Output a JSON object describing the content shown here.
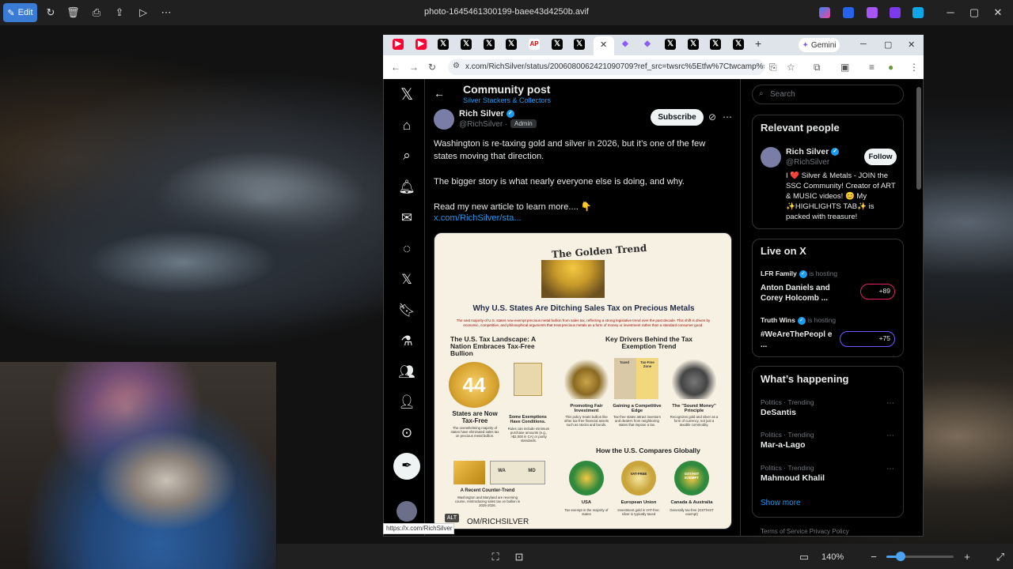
{
  "viewer": {
    "edit_label": "Edit",
    "title": "photo-1645461300199-baee43d4250b.avif",
    "zoom": "140%"
  },
  "browser": {
    "tab_labels": [
      "AP"
    ],
    "gemini_label": "Gemini",
    "address": "x.com/RichSilver/status/2006080062421090709?ref_src=twsrc%5Etfw%7Ctwcamp%5Etwe...",
    "status_url": "https://x.com/RichSilver"
  },
  "post": {
    "page_title": "Community post",
    "community": "Silver Stackers & Collectors",
    "author_name": "Rich Silver",
    "author_handle": "@RichSilver ·",
    "admin_badge": "Admin",
    "subscribe_label": "Subscribe",
    "para1": "Washington is re-taxing gold and silver in 2026, but it’s one of the few states moving that direction.",
    "para2": "The bigger story is what nearly everyone else is doing, and why.",
    "para3": "Read my new article to learn more.... 👇",
    "link": "x.com/RichSilver/sta...",
    "alt_badge": "ALT",
    "image_footer": "OM/RICHSILVER"
  },
  "infographic": {
    "trend_title": "The Golden Trend",
    "headline": "Why U.S. States Are Ditching Sales Tax on Precious Metals",
    "subline": "The vast majority of U.S. states now exempt precious metal bullion from sales tax, reflecting a strong legislative trend over the past decade. This shift is driven by economic, competitive, and philosophical arguments that treat precious metals as a form of money or investment rather than a standard consumer good.",
    "landscape_title": "The U.S. Tax Landscape: A Nation Embraces Tax-Free Bullion",
    "badge_number": "44",
    "states_now": "States are Now Tax-Free",
    "states_now_desc": "The overwhelming majority of states have eliminated sales tax on precious metal bullion.",
    "exemptions": "Some Exemptions Have Conditions.",
    "exemptions_desc": "Rules can include minimum purchase amounts (e.g., >$2,000 in CA) or purity standards.",
    "drivers_title": "Key Drivers Behind the Tax Exemption Trend",
    "drivers": [
      {
        "title": "Promoting Fair Investment",
        "desc": "This policy treats bullion like other tax-free financial assets such as stocks and bonds."
      },
      {
        "title": "Gaining a Competitive Edge",
        "desc": "Tax-free states attract investors and dealers from neighboring states that impose a tax."
      },
      {
        "title": "The \"Sound Money\" Principle",
        "desc": "Recognizes gold and silver as a form of currency, not just a taxable commodity."
      }
    ],
    "drivers_labels": [
      "Taxed",
      "Tax-Free Zone"
    ],
    "counter_title": "A Recent Counter-Trend",
    "counter_desc": "Washington and Maryland are reversing course, reintroducing sales tax on bullion in 2025-2026.",
    "counter_states": [
      "WA",
      "MD"
    ],
    "compare_title": "How the U.S. Compares Globally",
    "globes": [
      {
        "name": "USA",
        "desc": "Tax-exempt in the majority of states",
        "color": "#2f8a3d"
      },
      {
        "name": "European Union",
        "desc": "Investment gold is VAT-free; silver is typically taxed",
        "color": "#caa53c"
      },
      {
        "name": "Canada & Australia",
        "desc": "Generally tax-free (GST/HST exempt)",
        "color": "#2f8a3d"
      }
    ],
    "globe_badges": [
      "VAT-FREE",
      "GST/HST EXEMPT"
    ]
  },
  "sidebar": {
    "search_placeholder": "Search",
    "relevant_title": "Relevant people",
    "rp_name": "Rich Silver",
    "rp_handle": "@RichSilver",
    "follow_label": "Follow",
    "rp_bio": "I ❤️ Silver & Metals - JOIN the SSC Community! Creator of ART & MUSIC videos! 😊 My ✨HIGHLIGHTS TAB✨ is packed with treasure!",
    "live_title": "Live on X",
    "live": [
      {
        "host": "LFR Family",
        "hosting": "is hosting",
        "title": "Anton Daniels and Corey Holcomb ...",
        "count": "+89"
      },
      {
        "host": "Truth Wins",
        "hosting": "is hosting",
        "title": "#WeAreThePeopl e ...",
        "count": "+75"
      }
    ],
    "happening_title": "What’s happening",
    "trends": [
      {
        "category": "Politics · Trending",
        "name": "DeSantis"
      },
      {
        "category": "Politics · Trending",
        "name": "Mar-a-Lago"
      },
      {
        "category": "Politics · Trending",
        "name": "Mahmoud Khalil"
      }
    ],
    "show_more": "Show more",
    "footer": "Terms of Service    Privacy Policy"
  },
  "colors": {
    "accent": "#1d9bf0",
    "edit_button": "#3a7bd5",
    "live_red": "#e0245e",
    "live_purple": "#7856ff"
  }
}
